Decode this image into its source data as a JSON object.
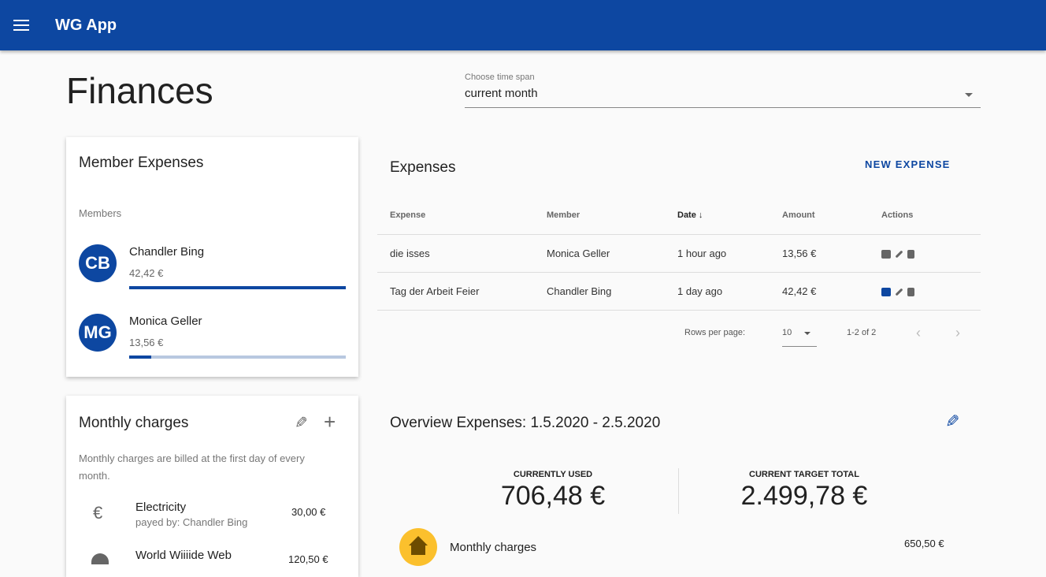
{
  "app": {
    "title": "WG App",
    "menu_icon": "menu-icon"
  },
  "page": {
    "title": "Finances"
  },
  "time_span": {
    "label": "Choose time span",
    "value": "current month"
  },
  "member_expenses": {
    "title": "Member Expenses",
    "subheader": "Members",
    "members": [
      {
        "initials": "CB",
        "name": "Chandler Bing",
        "amount": "42,42 €",
        "share_percent": 100
      },
      {
        "initials": "MG",
        "name": "Monica Geller",
        "amount": "13,56 €",
        "share_percent": 10
      }
    ]
  },
  "expenses": {
    "title": "Expenses",
    "new_label": "NEW EXPENSE",
    "columns": [
      "Expense",
      "Member",
      "Date",
      "Amount",
      "Actions"
    ],
    "rows": [
      {
        "expense": "die isses",
        "member": "Monica Geller",
        "date": "1 hour ago",
        "amount": "13,56 €",
        "photo": "add-photo-icon"
      },
      {
        "expense": "Tag der Arbeit Feier",
        "member": "Chandler Bing",
        "date": "1 day ago",
        "amount": "42,42 €",
        "photo": "camera-icon"
      }
    ],
    "rows_per_page_label": "Rows per page:",
    "rows_per_page": "10",
    "range": "1-2 of 2"
  },
  "monthly": {
    "title": "Monthly charges",
    "desc": "Monthly charges are billed at the first day of every month.",
    "items": [
      {
        "name": "Electricity",
        "sub": "payed by: Chandler Bing",
        "amount": "30,00 €",
        "icon": "euro-icon"
      },
      {
        "name": "World Wiiiide Web",
        "amount": "120,50 €",
        "icon": "wifi-icon"
      }
    ]
  },
  "overview": {
    "title": "Overview Expenses: 1.5.2020 - 2.5.2020",
    "used_label": "CURRENTLY USED",
    "used": "706,48 €",
    "target_label": "CURRENT TARGET TOTAL",
    "target": "2.499,78 €",
    "category": {
      "name": "Monthly charges",
      "amount": "650,50 €",
      "icon": "home-icon"
    }
  },
  "colors": {
    "primary": "#0d47a1",
    "accent_yellow": "#fbc02d"
  }
}
